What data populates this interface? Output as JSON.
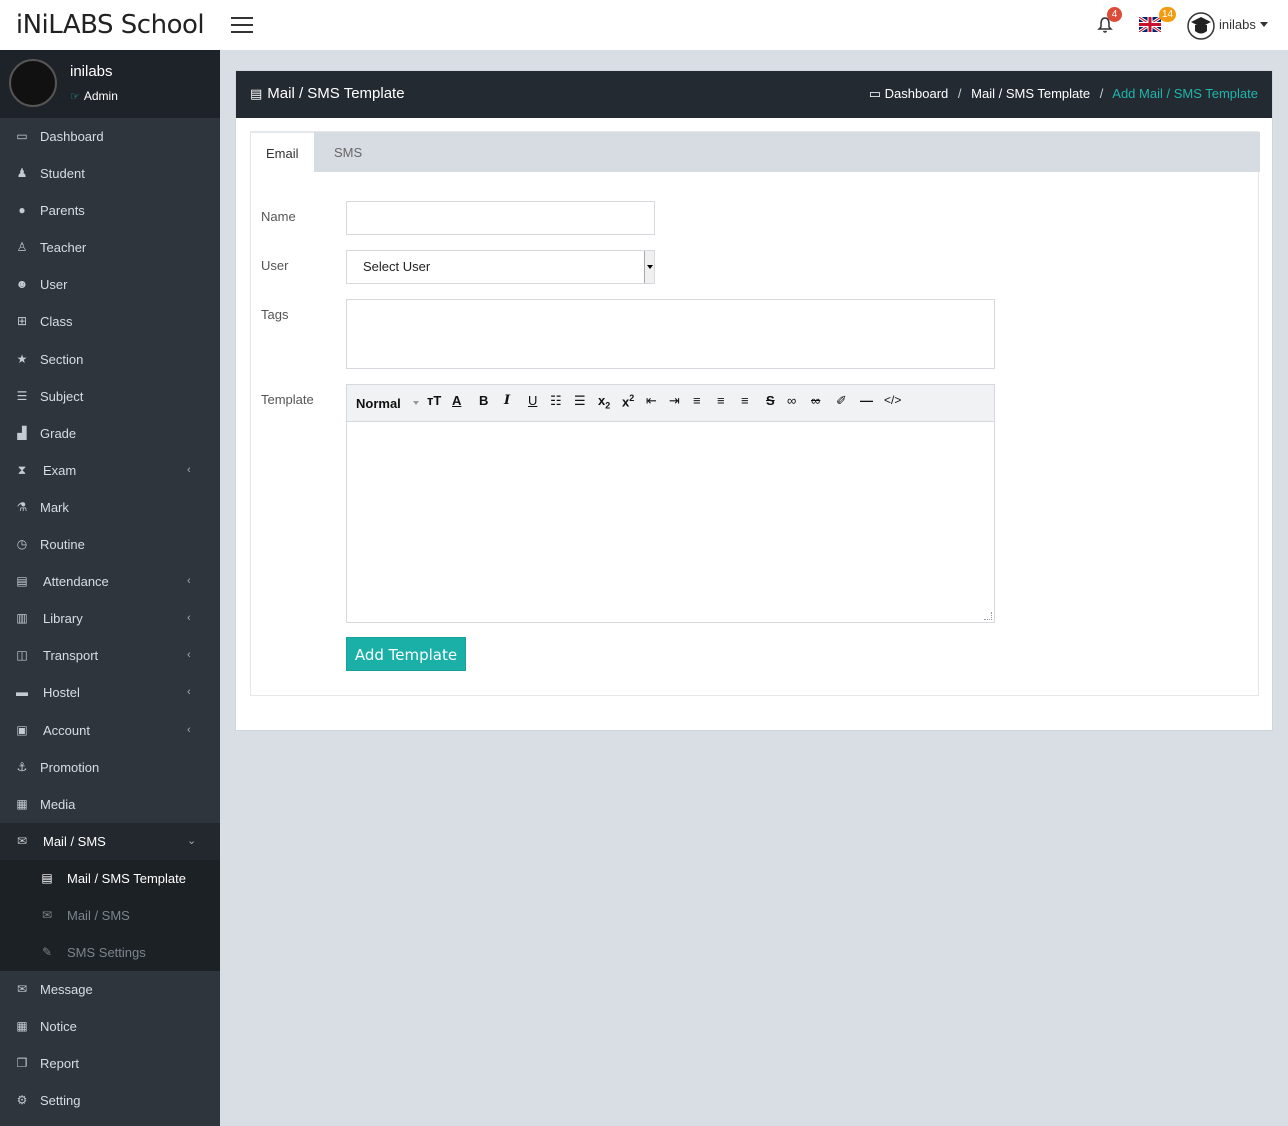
{
  "header": {
    "brand": "iNiLABS School",
    "notifications_count": "4",
    "language_count": "14",
    "user_name": "inilabs"
  },
  "sidebar": {
    "user": {
      "name": "inilabs",
      "role": "Admin"
    },
    "items": [
      {
        "label": "Dashboard",
        "icon": "laptop-icon",
        "glyph": "▭"
      },
      {
        "label": "Student",
        "icon": "student-icon",
        "glyph": "♟"
      },
      {
        "label": "Parents",
        "icon": "parents-icon",
        "glyph": "●"
      },
      {
        "label": "Teacher",
        "icon": "teacher-icon",
        "glyph": "♙"
      },
      {
        "label": "User",
        "icon": "users-icon",
        "glyph": "☻"
      },
      {
        "label": "Class",
        "icon": "sitemap-icon",
        "glyph": "⊞"
      },
      {
        "label": "Section",
        "icon": "star-icon",
        "glyph": "★"
      },
      {
        "label": "Subject",
        "icon": "book-icon",
        "glyph": "☰"
      },
      {
        "label": "Grade",
        "icon": "signal-icon",
        "glyph": "▟"
      },
      {
        "label": "Exam",
        "icon": "hourglass-icon",
        "glyph": "⧗",
        "has_arrow": true
      },
      {
        "label": "Mark",
        "icon": "flask-icon",
        "glyph": "⚗"
      },
      {
        "label": "Routine",
        "icon": "clock-icon",
        "glyph": "◷"
      },
      {
        "label": "Attendance",
        "icon": "clipboard-icon",
        "glyph": "▤",
        "has_arrow": true
      },
      {
        "label": "Library",
        "icon": "library-icon",
        "glyph": "▥",
        "has_arrow": true
      },
      {
        "label": "Transport",
        "icon": "bus-icon",
        "glyph": "◫",
        "has_arrow": true
      },
      {
        "label": "Hostel",
        "icon": "bed-icon",
        "glyph": "▬",
        "has_arrow": true
      },
      {
        "label": "Account",
        "icon": "money-icon",
        "glyph": "▣",
        "has_arrow": true
      },
      {
        "label": "Promotion",
        "icon": "promotion-icon",
        "glyph": "⚓"
      },
      {
        "label": "Media",
        "icon": "film-icon",
        "glyph": "▦"
      },
      {
        "label": "Mail / SMS",
        "icon": "mail-sms-icon",
        "glyph": "✉",
        "has_arrow": true,
        "open": true
      }
    ],
    "submenu": [
      {
        "label": "Mail / SMS Template",
        "icon": "template-icon",
        "glyph": "▤",
        "active": true
      },
      {
        "label": "Mail / SMS",
        "icon": "envelope-open-icon",
        "glyph": "✉"
      },
      {
        "label": "SMS Settings",
        "icon": "wrench-icon",
        "glyph": "✎"
      }
    ],
    "items_after": [
      {
        "label": "Message",
        "icon": "envelope-icon",
        "glyph": "✉"
      },
      {
        "label": "Notice",
        "icon": "calendar-icon",
        "glyph": "▦"
      },
      {
        "label": "Report",
        "icon": "copy-icon",
        "glyph": "❐"
      },
      {
        "label": "Setting",
        "icon": "gears-icon",
        "glyph": "⚙"
      }
    ]
  },
  "page": {
    "title": "Mail / SMS Template",
    "breadcrumb": [
      "Dashboard",
      "Mail / SMS Template",
      "Add Mail / SMS Template"
    ]
  },
  "tabs": [
    "Email",
    "SMS"
  ],
  "form": {
    "name_label": "Name",
    "name_value": "",
    "user_label": "User",
    "user_selected": "Select User",
    "tags_label": "Tags",
    "template_label": "Template",
    "editor_format": "Normal",
    "submit_label": "Add Template"
  },
  "colors": {
    "accent": "#1ab0a8",
    "sidebar_bg": "#2e353d",
    "header_dark": "#242a31",
    "badge_red": "#dd4b39",
    "badge_orange": "#f39c12"
  }
}
